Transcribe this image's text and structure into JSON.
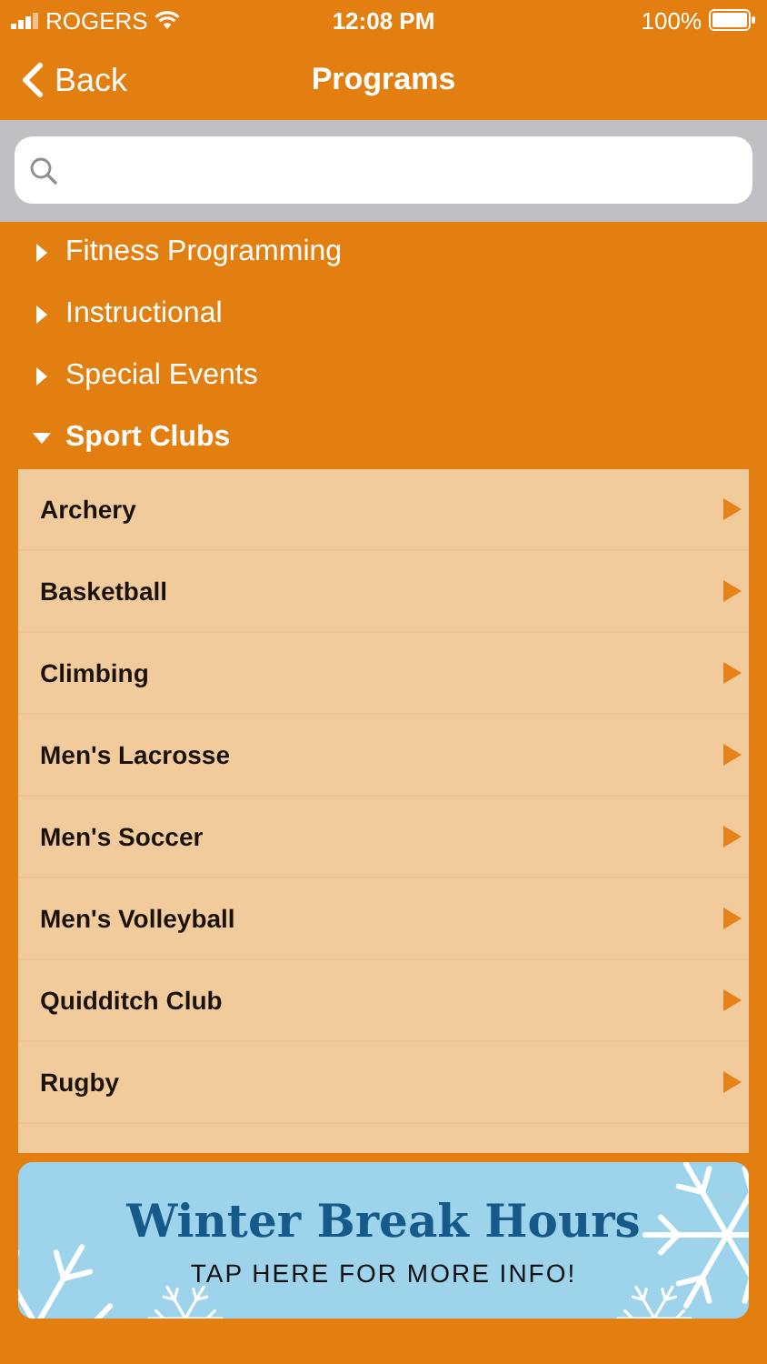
{
  "status_bar": {
    "carrier": "ROGERS",
    "time": "12:08 PM",
    "battery": "100%"
  },
  "nav": {
    "back": "Back",
    "title": "Programs"
  },
  "categories": [
    {
      "label": "Fitness Programming",
      "expanded": false
    },
    {
      "label": "Instructional",
      "expanded": false
    },
    {
      "label": "Special Events",
      "expanded": false
    },
    {
      "label": "Sport Clubs",
      "expanded": true,
      "children": [
        {
          "label": "Archery"
        },
        {
          "label": "Basketball"
        },
        {
          "label": "Climbing"
        },
        {
          "label": "Men's Lacrosse"
        },
        {
          "label": "Men's Soccer"
        },
        {
          "label": "Men's Volleyball"
        },
        {
          "label": "Quidditch Club"
        },
        {
          "label": "Rugby"
        }
      ]
    }
  ],
  "banner": {
    "title": "Winter Break Hours",
    "subtitle": "TAP HERE FOR MORE INFO!"
  }
}
